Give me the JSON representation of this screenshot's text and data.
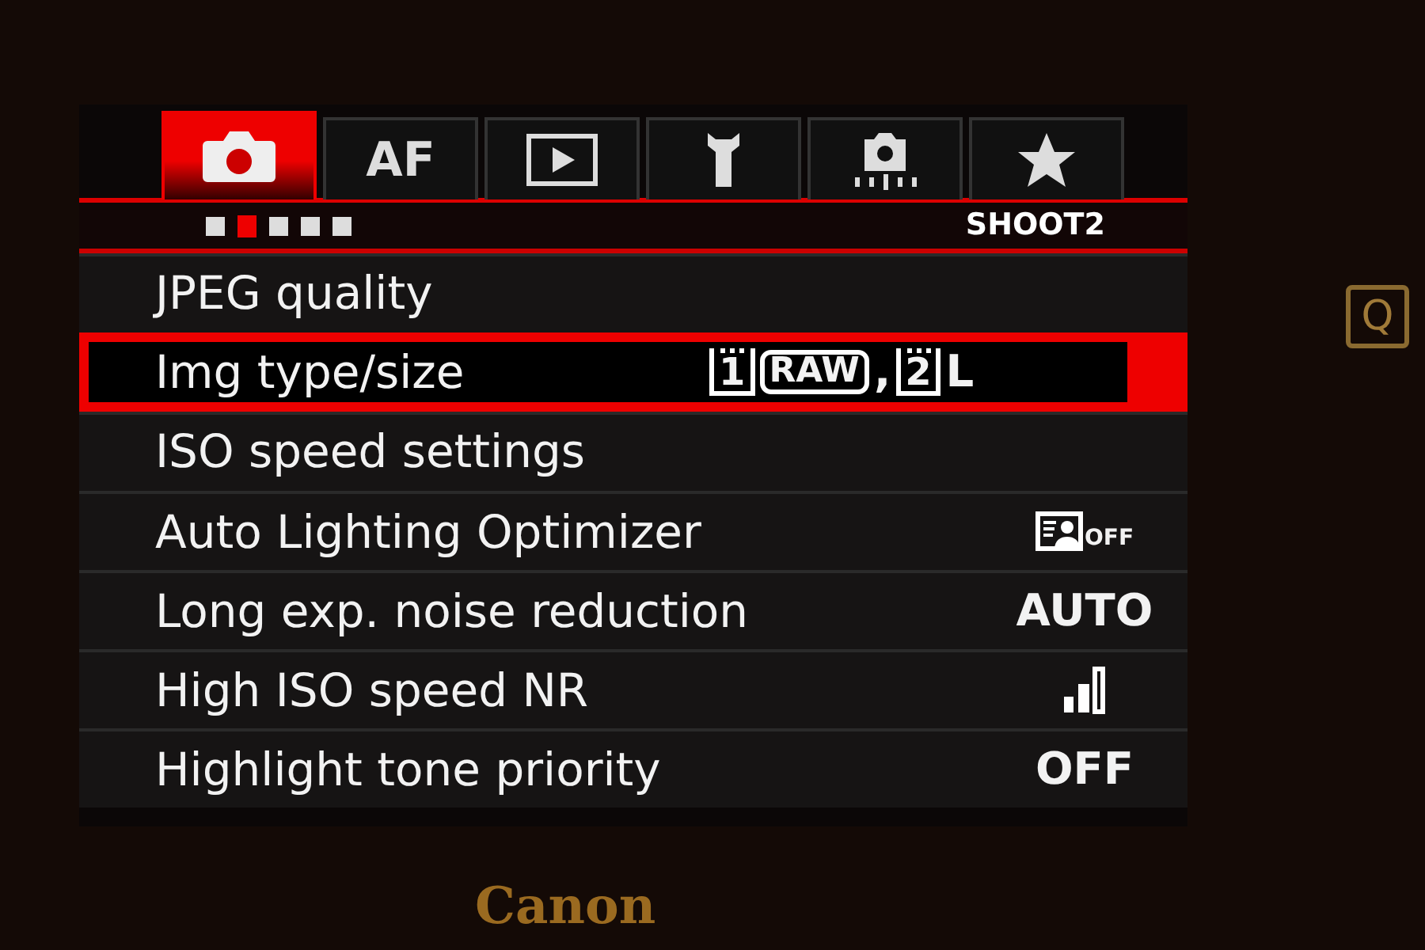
{
  "tabs": [
    {
      "kind": "camera",
      "selected": true
    },
    {
      "kind": "text",
      "label": "AF",
      "selected": false
    },
    {
      "kind": "play",
      "selected": false
    },
    {
      "kind": "wrench",
      "selected": false
    },
    {
      "kind": "custom",
      "selected": false
    },
    {
      "kind": "star",
      "selected": false
    }
  ],
  "pages": [
    {
      "selected": false
    },
    {
      "selected": true
    },
    {
      "selected": false
    },
    {
      "selected": false
    },
    {
      "selected": false
    }
  ],
  "page_title": "SHOOT2",
  "items": [
    {
      "label": "JPEG quality",
      "selected": false
    },
    {
      "label": "Img type/size",
      "selected": true,
      "value_parts": [
        {
          "kind": "card",
          "text": "1"
        },
        {
          "kind": "badge",
          "text": "RAW"
        },
        {
          "kind": "plain",
          "text": ","
        },
        {
          "kind": "card",
          "text": "2"
        },
        {
          "kind": "plain",
          "text": "L"
        }
      ]
    },
    {
      "label": "ISO speed settings",
      "selected": false
    },
    {
      "label": "Auto Lighting Optimizer",
      "selected": false,
      "kind": "icon_text",
      "value": "OFF"
    },
    {
      "label": "Long exp. noise reduction",
      "selected": false,
      "value": "AUTO"
    },
    {
      "label": "High ISO speed NR",
      "selected": false,
      "kind": "level_icon"
    },
    {
      "label": "Highlight tone priority",
      "selected": false,
      "value": "OFF"
    }
  ],
  "camera_body": {
    "q_button": "Q",
    "brand": "Canon"
  }
}
